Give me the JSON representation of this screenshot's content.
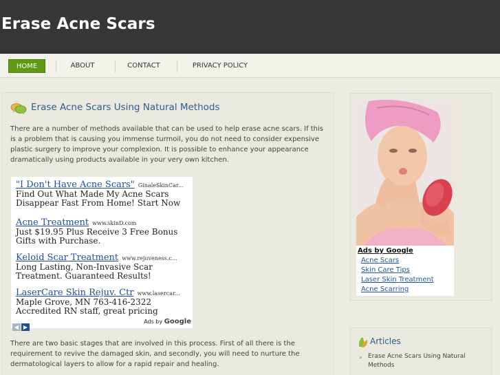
{
  "site": {
    "title": "Erase Acne Scars"
  },
  "nav": {
    "items": [
      {
        "label": "HOME"
      },
      {
        "label": "ABOUT"
      },
      {
        "label": "CONTACT"
      },
      {
        "label": "PRIVACY POLICY"
      }
    ],
    "active_color": "#5f9a12"
  },
  "post": {
    "title": "Erase Acne Scars Using Natural Methods",
    "para1": "There are a number of methods available that can be used to help erase acne scars. If this is a problem that is causing you immense turmoil, you do not need to consider expensive plastic surgery to improve your complexion. It is possible to enhance your appearance dramatically using products available in your very own kitchen.",
    "para2": "There are two basic stages that are involved in this process. First of all there is the requirement to revive the damaged skin, and secondly, you will need to nurture the dermatological layers to allow for a rapid repair and healing."
  },
  "adblock": {
    "ads": [
      {
        "title": "\"I Don't Have Acne Scars\"",
        "url": "GinaleSkinCar...",
        "desc": "Find Out What Made My Acne Scars Disappear Fast From Home! Start Now"
      },
      {
        "title": "Acne Treatment",
        "url": "www.skinD.com",
        "desc": "Just $19.95 Plus Receive 3 Free Bonus Gifts with Purchase."
      },
      {
        "title": "Keloid Scar Treatment",
        "url": "www.rejuveness.c...",
        "desc": "Long Lasting, Non-Invasive Scar Treatment. Guaranteed Results!"
      },
      {
        "title": "LaserCare Skin Rejuv. Ctr",
        "url": "www.lasercar...",
        "desc": "Maple Grove, MN 763-416-2322 Accredited RN staff, great pricing"
      }
    ],
    "ads_by_prefix": "Ads by",
    "ads_by_brand": "Google",
    "prev_icon": "chevron-left-icon",
    "next_icon": "chevron-right-icon"
  },
  "sidebar": {
    "ads_title": "Ads by Google",
    "ads_links": [
      "Acne Scars",
      "Skin Care Tips",
      "Laser Skin Treatment",
      "Acne Scarring"
    ],
    "articles_title": "Articles",
    "articles": [
      "Erase Acne Scars Using Natural Methods"
    ]
  }
}
